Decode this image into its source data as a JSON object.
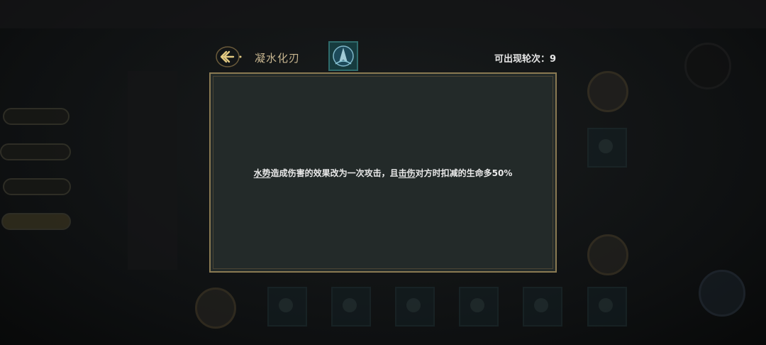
{
  "header": {
    "title": "凝水化刃",
    "appear_label": "可出现轮次：",
    "appear_value": "9"
  },
  "dialog": {
    "desc_parts": {
      "kw1": "水势",
      "text1": "造成伤害的效果改为一次攻击，且",
      "kw2": "击伤",
      "text2": "对方时扣减的生命多50%"
    }
  },
  "colors": {
    "title": "#c8b690",
    "frame_gold": "#8a7a52",
    "dialog_bg": "#232a29"
  },
  "icons": {
    "back": "back-arrow-icon",
    "skill": "water-blade-skill-icon"
  }
}
